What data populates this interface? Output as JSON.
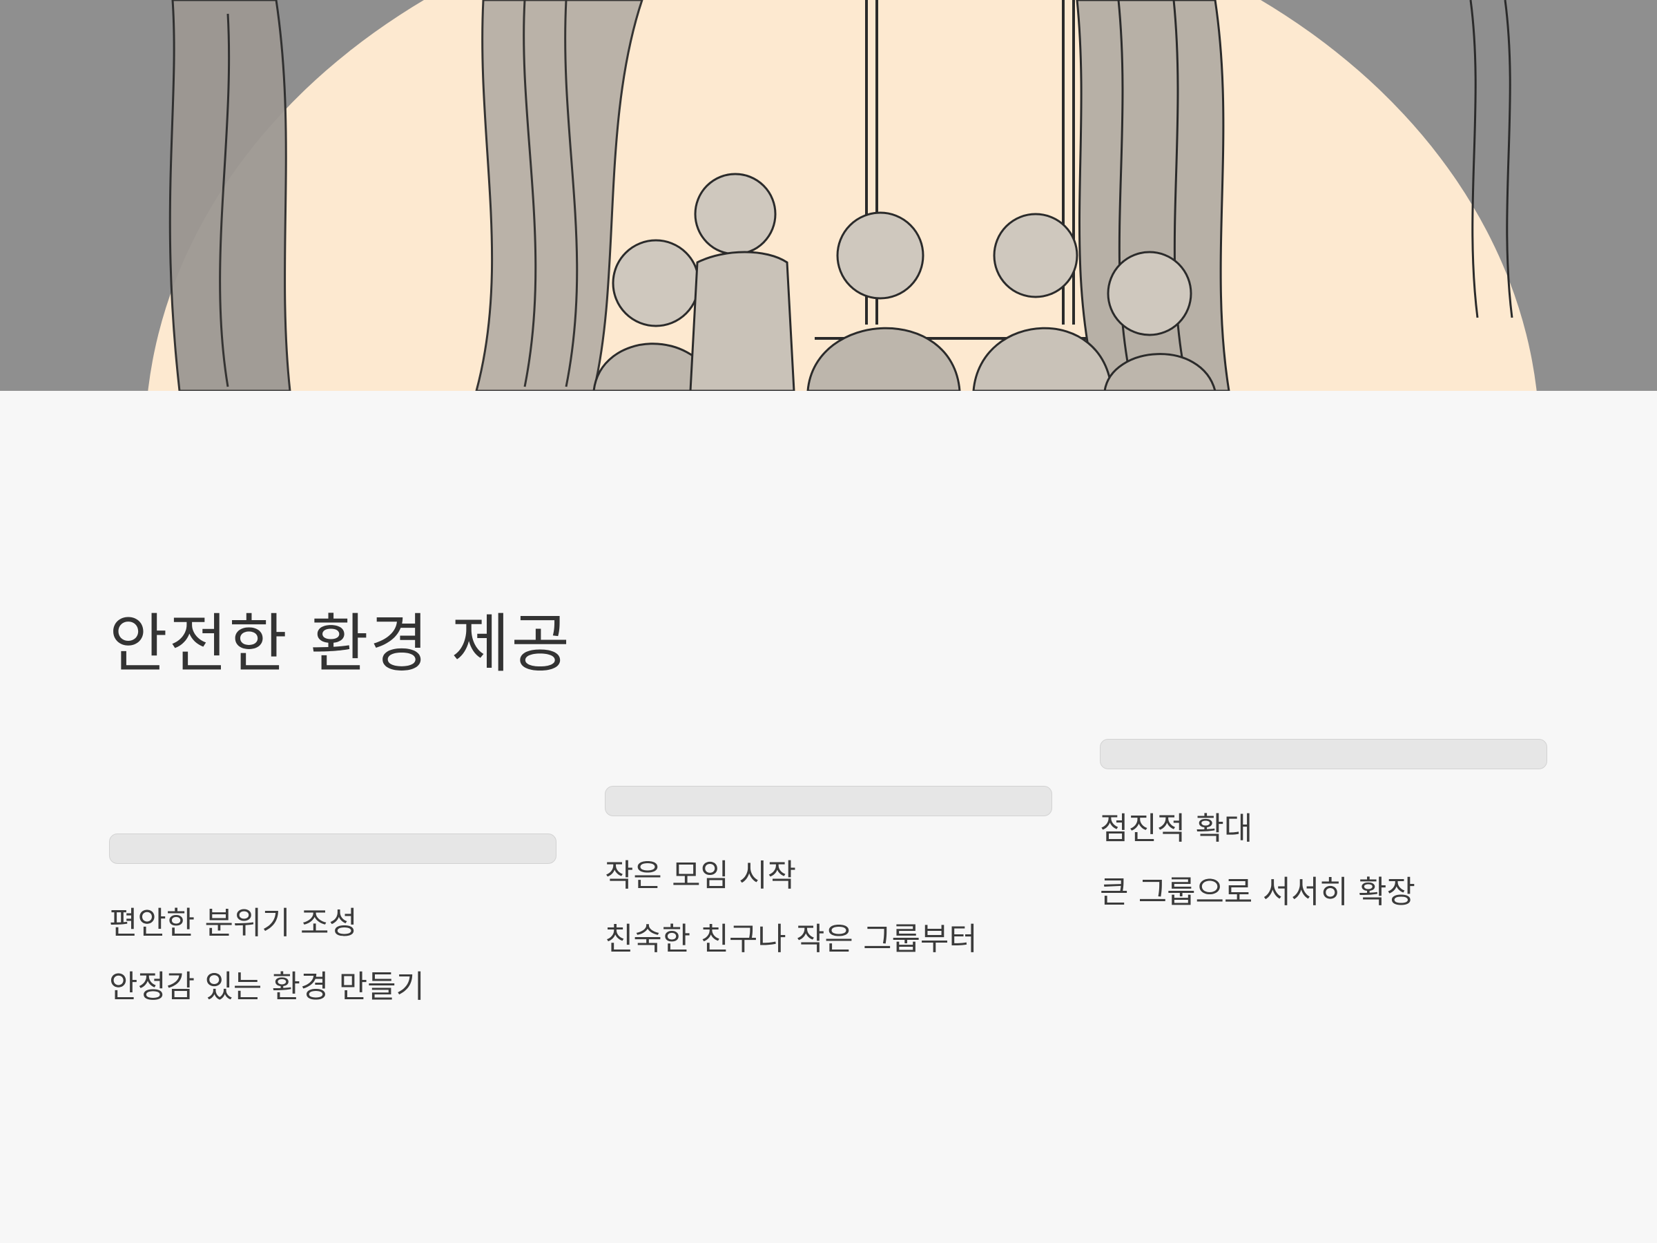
{
  "slide": {
    "title": "안전한 환경 제공"
  },
  "columns": [
    {
      "heading": "편안한 분위기 조성",
      "text": "안정감 있는 환경 만들기"
    },
    {
      "heading": "작은 모임 시작",
      "text": "친숙한 친구나 작은 그룹부터"
    },
    {
      "heading": "점진적 확대",
      "text": "큰 그룹으로 서서히 확장"
    }
  ],
  "colors": {
    "background": "#f7f7f7",
    "banner_dark": "#8f8f8f",
    "banner_light": "#fde9d0",
    "bar": "#e6e6e6",
    "text": "#3a3a3a"
  }
}
